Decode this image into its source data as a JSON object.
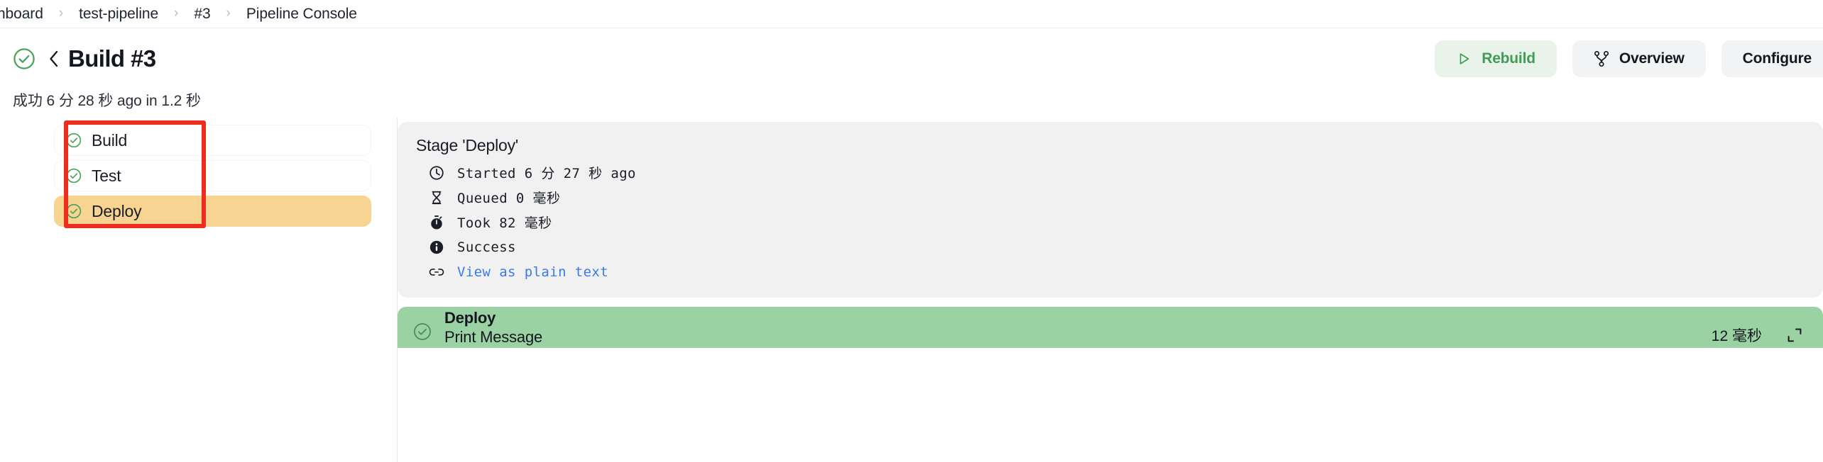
{
  "breadcrumb": {
    "items": [
      {
        "label": "ashboard"
      },
      {
        "label": "test-pipeline"
      },
      {
        "label": "#3"
      },
      {
        "label": "Pipeline Console"
      }
    ],
    "separator": "›"
  },
  "header": {
    "status_icon": "check-circle-icon",
    "back_icon": "chevron-left-icon",
    "title": "Build #3",
    "status_line": "成功 6 分 28 秒 ago in 1.2 秒",
    "actions": [
      {
        "label": "Rebuild",
        "icon": "play-icon",
        "style": "green"
      },
      {
        "label": "Overview",
        "icon": "branch-icon",
        "style": "plain"
      },
      {
        "label": "Configure",
        "icon": "none",
        "style": "plain"
      }
    ]
  },
  "stages": {
    "items": [
      {
        "label": "Build",
        "status": "success",
        "selected": false
      },
      {
        "label": "Test",
        "status": "success",
        "selected": false
      },
      {
        "label": "Deploy",
        "status": "success",
        "selected": true
      }
    ],
    "annotation_color": "#ef2d1f",
    "selected_color": "#f7d492"
  },
  "detail": {
    "title": "Stage 'Deploy'",
    "rows": [
      {
        "icon": "clock-icon",
        "text": "Started 6 分 27 秒 ago",
        "link": false
      },
      {
        "icon": "hourglass-icon",
        "text": "Queued 0 毫秒",
        "link": false
      },
      {
        "icon": "stopwatch-icon",
        "text": "Took 82 毫秒",
        "link": false
      },
      {
        "icon": "info-icon",
        "text": "Success",
        "link": false
      },
      {
        "icon": "link-icon",
        "text": "View as plain text",
        "link": true
      }
    ]
  },
  "step": {
    "status_icon": "check-circle-icon",
    "name": "Deploy",
    "subtitle": "Print Message",
    "duration": "12 毫秒",
    "expand_icon": "expand-icon",
    "background": "#9ad2a3"
  }
}
